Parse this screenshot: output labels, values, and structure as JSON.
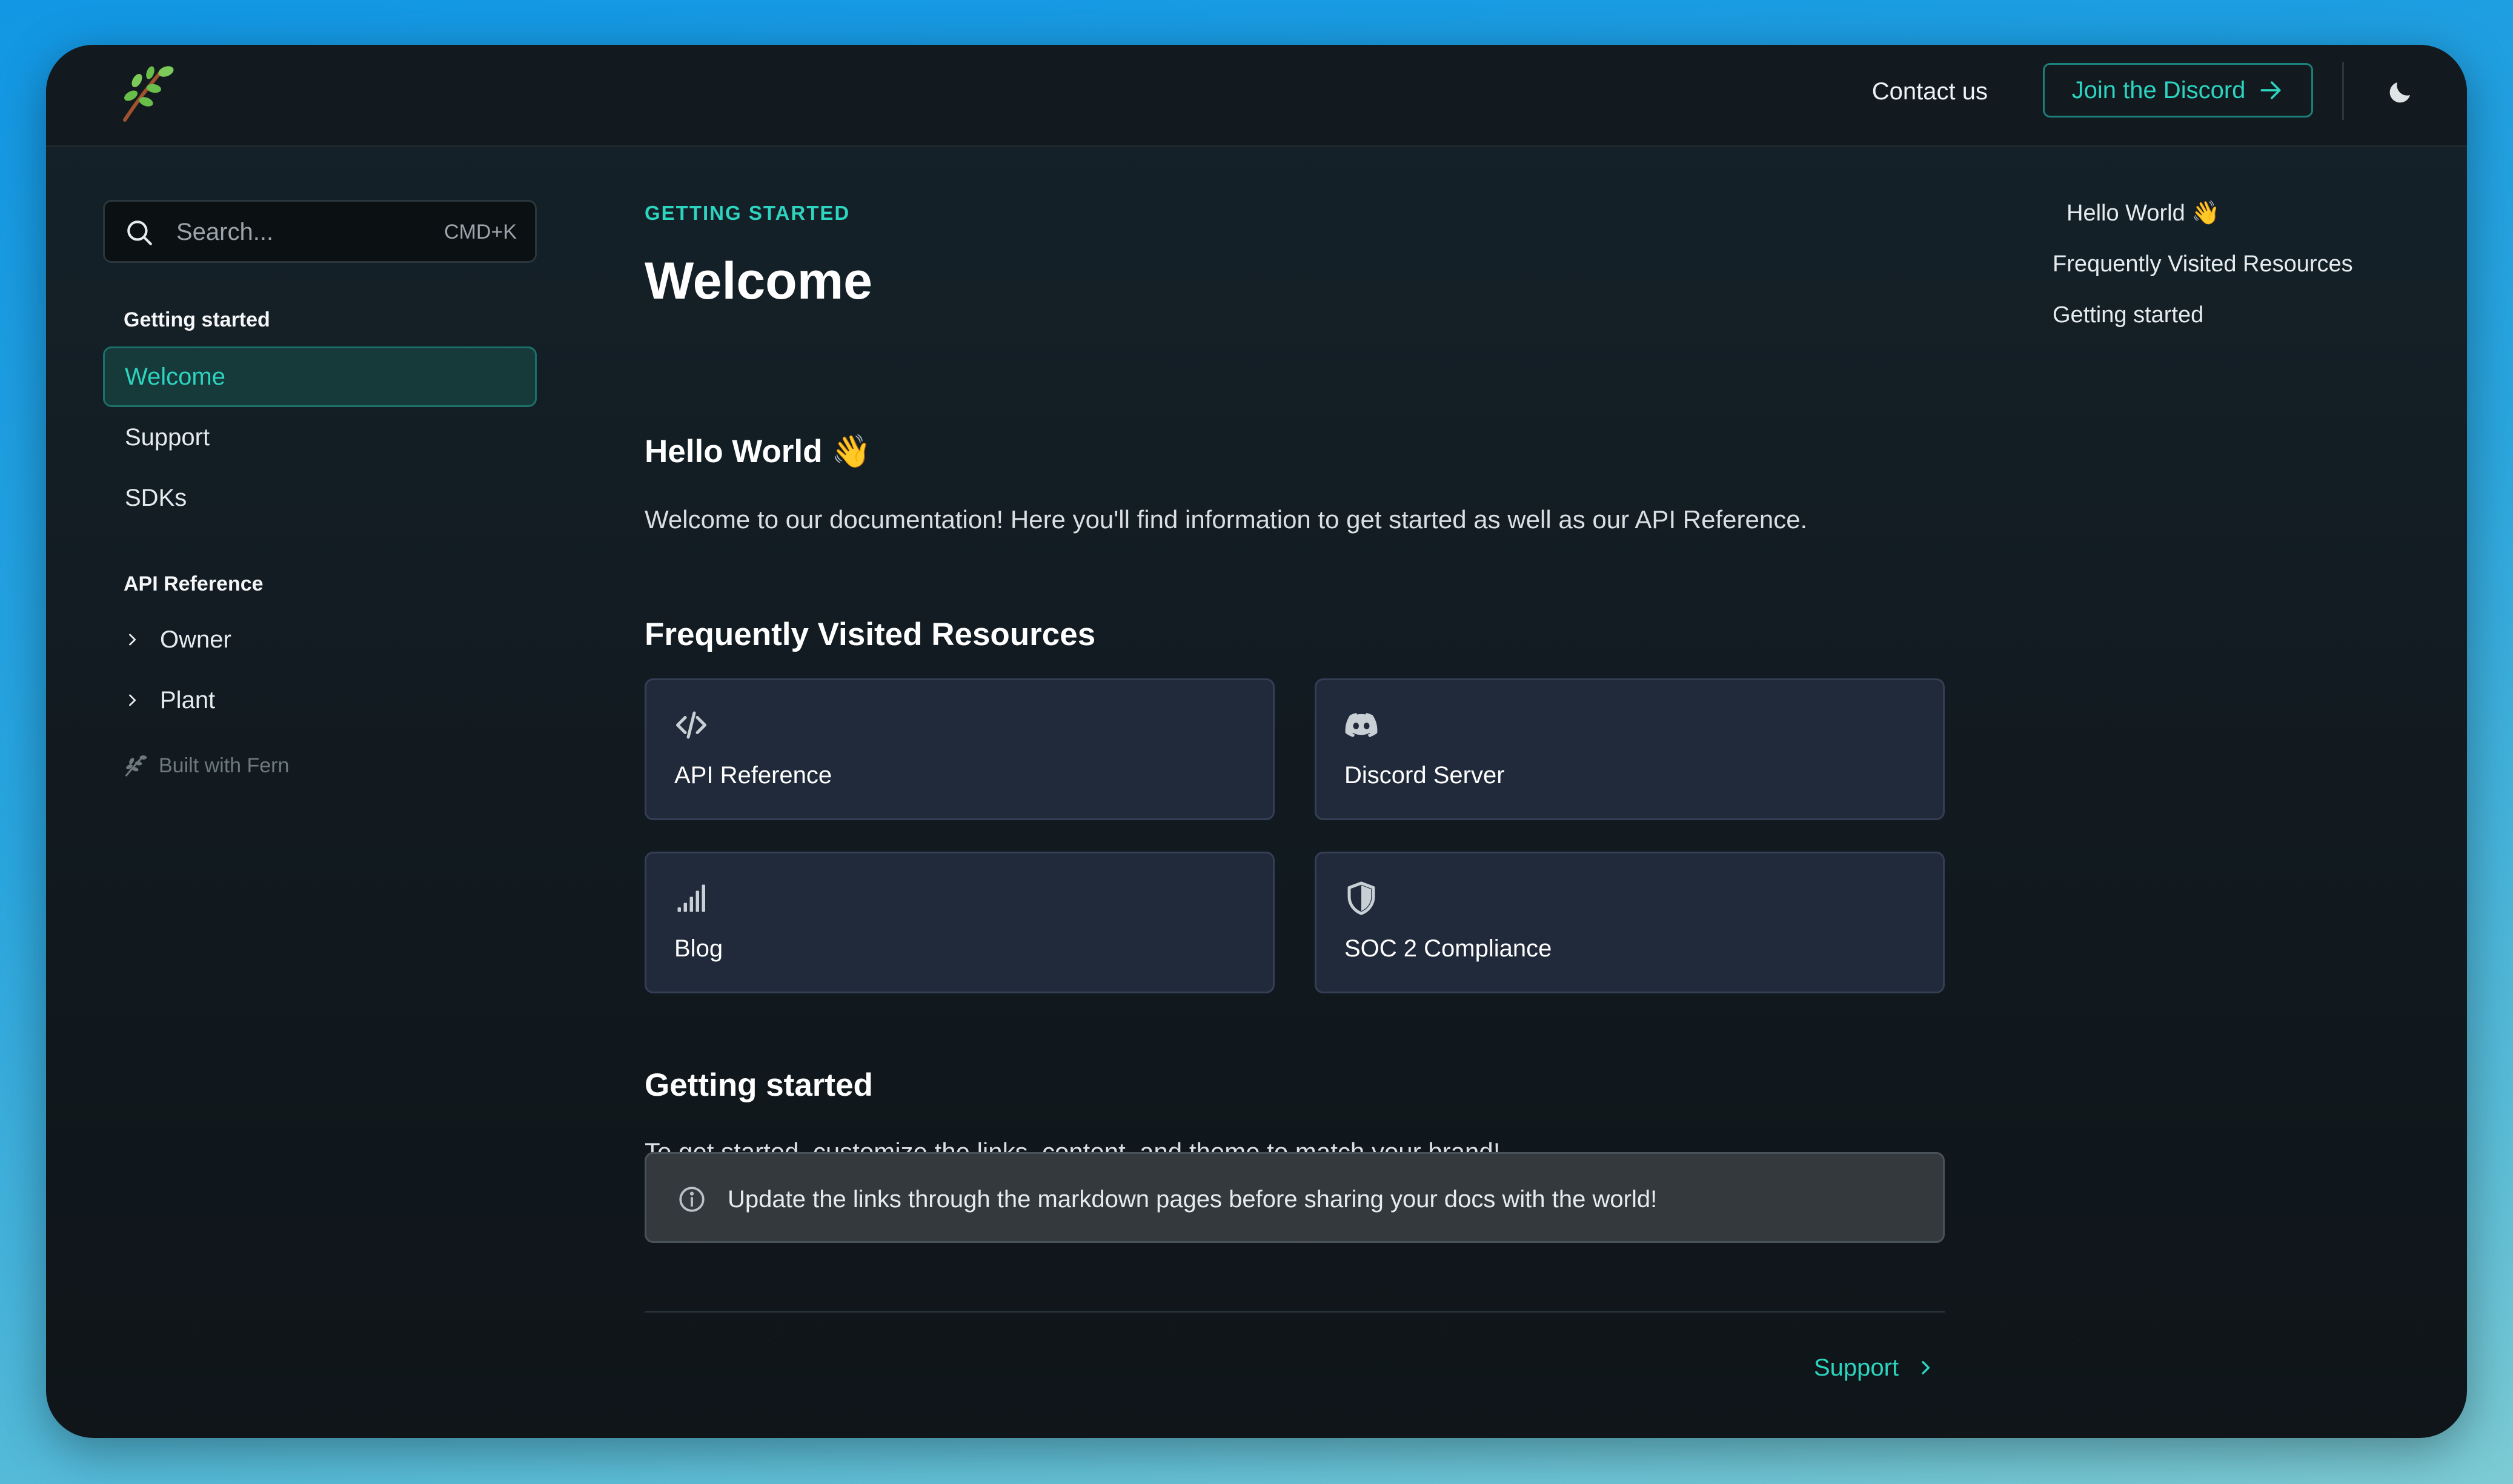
{
  "header": {
    "logo_icon": "fern-leaf-icon",
    "contact_label": "Contact us",
    "discord_label": "Join the Discord",
    "discord_icon": "arrow-right-icon",
    "theme_icon": "moon-icon"
  },
  "search": {
    "placeholder": "Search...",
    "shortcut": "CMD+K",
    "icon": "search-icon"
  },
  "sidebar": {
    "sections": [
      {
        "title": "Getting started",
        "items": [
          {
            "label": "Welcome",
            "active": true
          },
          {
            "label": "Support",
            "active": false
          },
          {
            "label": "SDKs",
            "active": false
          }
        ]
      },
      {
        "title": "API Reference",
        "items": [
          {
            "label": "Owner",
            "expandable": true
          },
          {
            "label": "Plant",
            "expandable": true
          }
        ]
      }
    ],
    "built_with": "Built with Fern"
  },
  "main": {
    "eyebrow": "GETTING STARTED",
    "title": "Welcome",
    "hello_heading": "Hello World 👋",
    "hello_text": "Welcome to our documentation! Here you'll find information to get started as well as our API Reference.",
    "resources_heading": "Frequently Visited Resources",
    "cards": [
      {
        "label": "API Reference",
        "icon": "code-icon"
      },
      {
        "label": "Discord Server",
        "icon": "discord-icon"
      },
      {
        "label": "Blog",
        "icon": "signal-bars-icon"
      },
      {
        "label": "SOC 2 Compliance",
        "icon": "shield-icon"
      }
    ],
    "getting_started_heading": "Getting started",
    "getting_started_text": "To get started, customize the links, content, and theme to match your brand!",
    "callout_text": "Update the links through the markdown pages before sharing your docs with the world!",
    "callout_icon": "info-icon",
    "next_label": "Support"
  },
  "toc": {
    "items": [
      "Hello World 👋",
      "Frequently Visited Resources",
      "Getting started"
    ]
  },
  "colors": {
    "accent": "#2dd4bf",
    "background": "#121a1f",
    "card": "#202a3a"
  }
}
